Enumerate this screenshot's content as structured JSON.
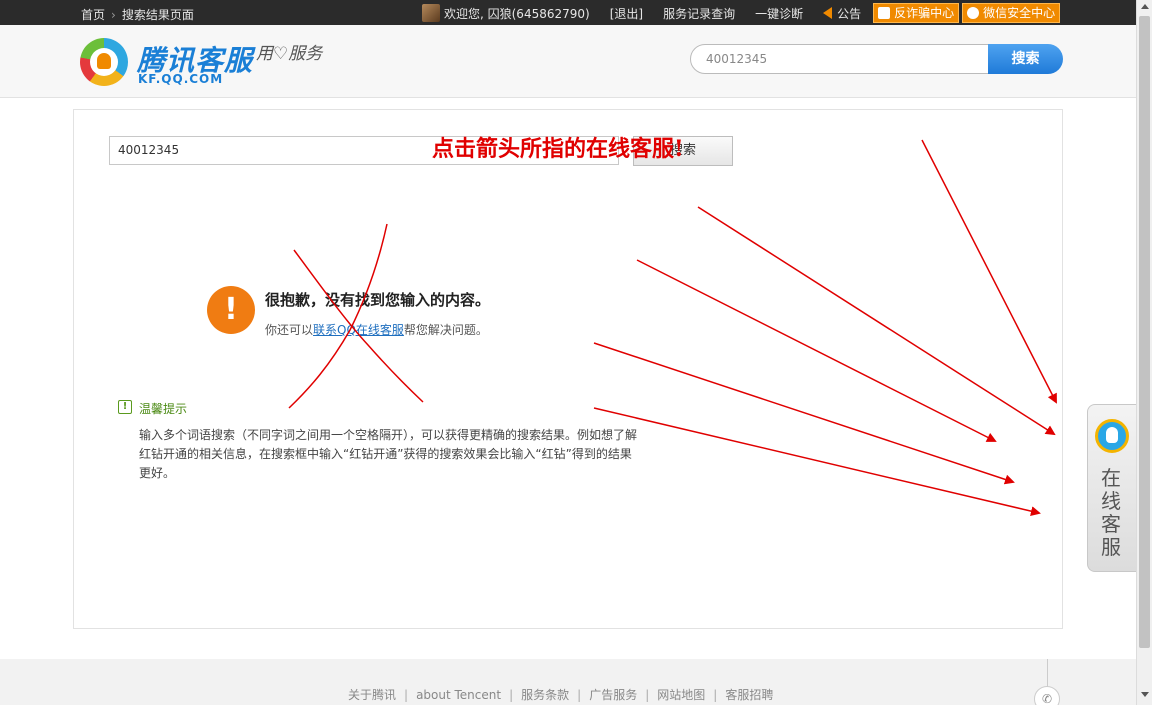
{
  "topbar": {
    "home": "首页",
    "current": "搜索结果页面",
    "welcome": "欢迎您, 囚狼(645862790)",
    "logout": "[退出]",
    "records": "服务记录查询",
    "diagnose": "一键诊断",
    "notice": "公告",
    "anti_fraud": "反诈骗中心",
    "wechat_security": "微信安全中心"
  },
  "header": {
    "logo_title": "腾讯客服",
    "logo_url_text": "KF.QQ.COM",
    "slogan": "用♡服务",
    "search_value": "40012345",
    "search_button": "搜索"
  },
  "main": {
    "search_value": "40012345",
    "search_button": "搜索",
    "instruction": "点击箭头所指的在线客服!",
    "sorry_title": "很抱歉，没有找到您输入的内容。",
    "sorry_prefix": "你还可以",
    "sorry_link": "联系QQ在线客服",
    "sorry_suffix": "帮您解决问题。",
    "tips_icon": "!",
    "tips_title": "温馨提示",
    "tips_body": "输入多个词语搜索（不同字词之间用一个空格隔开），可以获得更精确的搜索结果。例如想了解红钻开通的相关信息，在搜索框中输入“红钻开通”获得的搜索效果会比输入“红钻”得到的结果更好。"
  },
  "float_service": {
    "label": "在线客服"
  },
  "footer": {
    "links": [
      "关于腾讯",
      "about Tencent",
      "服务条款",
      "广告服务",
      "网站地图",
      "客服招聘"
    ]
  },
  "annotation_color": "#e00000"
}
